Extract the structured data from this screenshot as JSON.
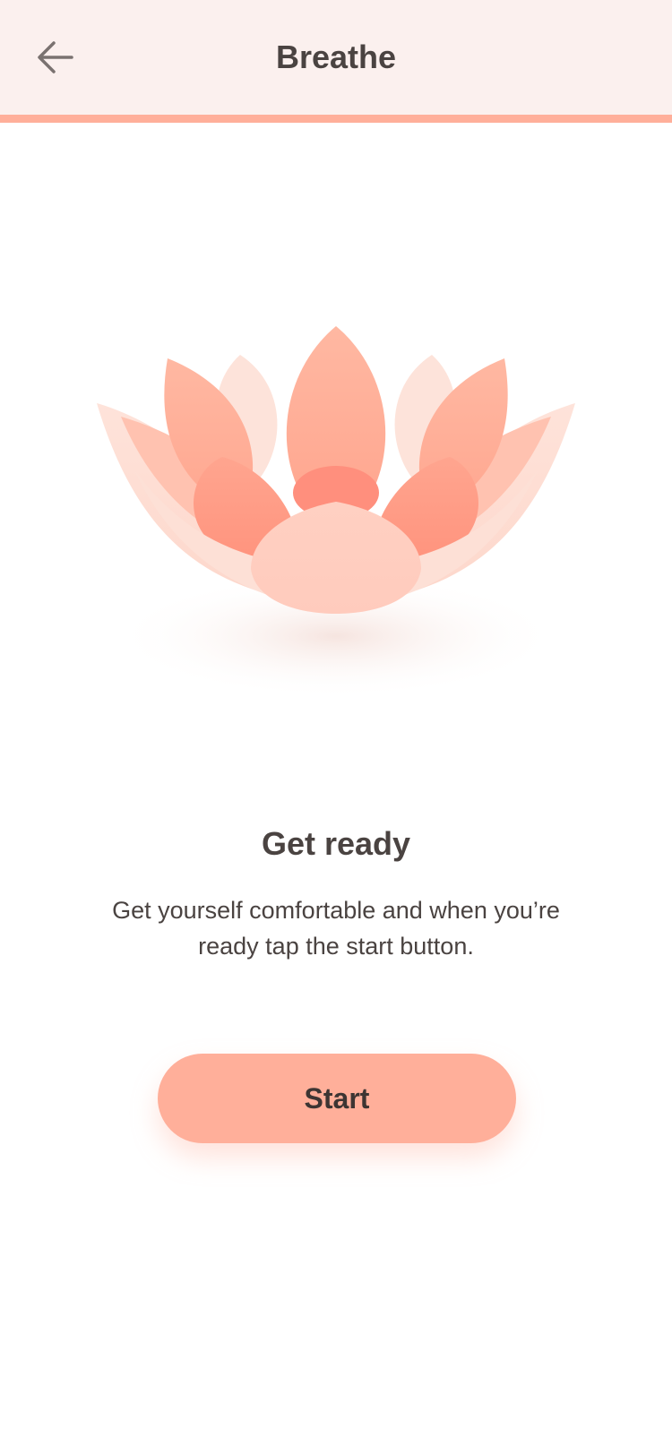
{
  "header": {
    "title": "Breathe",
    "back_icon": "arrow-left-icon"
  },
  "illustration": {
    "icon": "lotus-flower-icon"
  },
  "content": {
    "heading": "Get ready",
    "body": "Get yourself comfortable and when you’re ready tap the start button."
  },
  "actions": {
    "start_label": "Start"
  },
  "colors": {
    "accent": "#ffaf9a",
    "header_background": "#fbf0ee",
    "text": "#4a4341",
    "background": "#ffffff"
  }
}
